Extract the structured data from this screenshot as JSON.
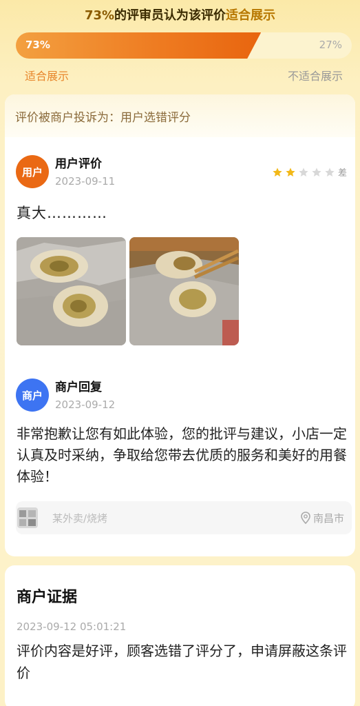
{
  "vote": {
    "pct_text": "73%",
    "mid_text": "的评审员认为该评价",
    "highlight_text": "适合展示",
    "percent_suitable": 73,
    "suitable_label": "73%",
    "unsuitable_label": "27%",
    "suitable_caption": "适合展示",
    "unsuitable_caption": "不适合展示"
  },
  "complaint": {
    "text": "评价被商户投诉为：用户选错评分"
  },
  "review": {
    "avatar_text": "用户",
    "name": "用户评价",
    "date": "2023-09-11",
    "stars": 2,
    "max_stars": 5,
    "rating_label": "差",
    "text": "真大…………"
  },
  "reply": {
    "avatar_text": "商户",
    "name": "商户回复",
    "date": "2023-09-12",
    "text": "非常抱歉让您有如此体验，您的批评与建议，小店一定认真及时采纳，争取给您带去优质的服务和美好的用餐体验！"
  },
  "shop": {
    "name": "某外卖/烧烤",
    "location": "南昌市"
  },
  "evidence": {
    "title": "商户证据",
    "time": "2023-09-12 05:01:21",
    "text": "评价内容是好评，顾客选错了评分了，申请屏蔽这条评价"
  },
  "colors": {
    "accent": "#ea6914",
    "merchant": "#3d74f2",
    "star": "#f2b818",
    "star_off": "#d8d8d8"
  }
}
